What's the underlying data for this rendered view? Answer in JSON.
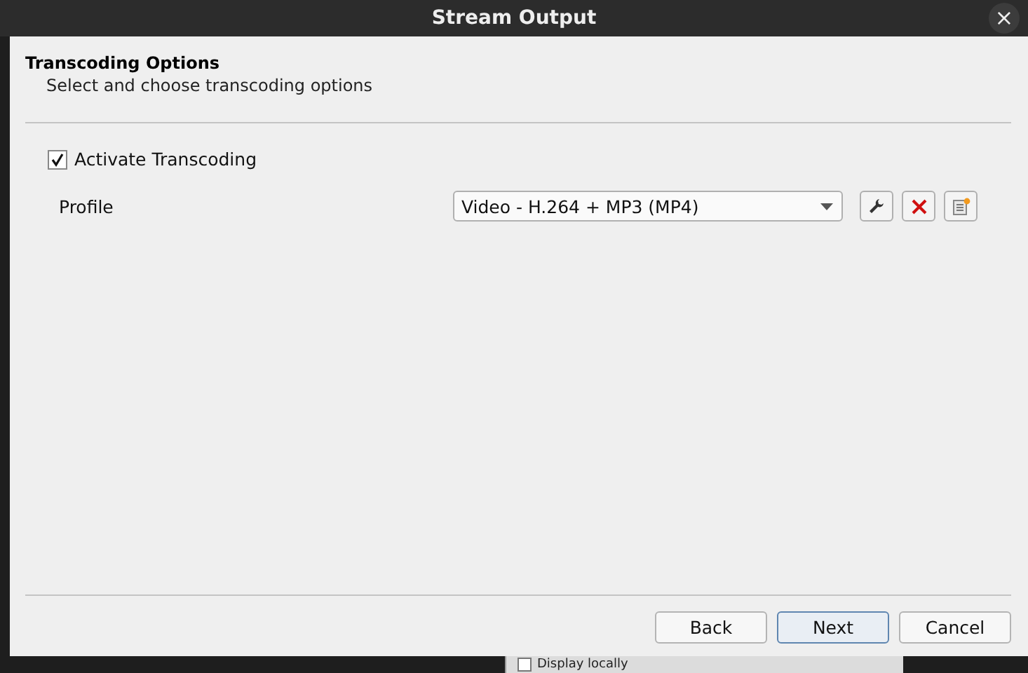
{
  "window": {
    "title": "Stream Output",
    "close": "×"
  },
  "header": {
    "title": "Transcoding Options",
    "subtitle": "Select and choose transcoding options"
  },
  "activate": {
    "label": "Activate Transcoding",
    "checked": true
  },
  "profile": {
    "label": "Profile",
    "value": "Video - H.264 + MP3 (MP4)"
  },
  "buttons": [
    {
      "label": "Back",
      "default": false
    },
    {
      "label": "Next",
      "default": true
    },
    {
      "label": "Cancel",
      "default": false
    }
  ],
  "background_window": {
    "option": {
      "label": "Display locally",
      "checked": false
    }
  }
}
